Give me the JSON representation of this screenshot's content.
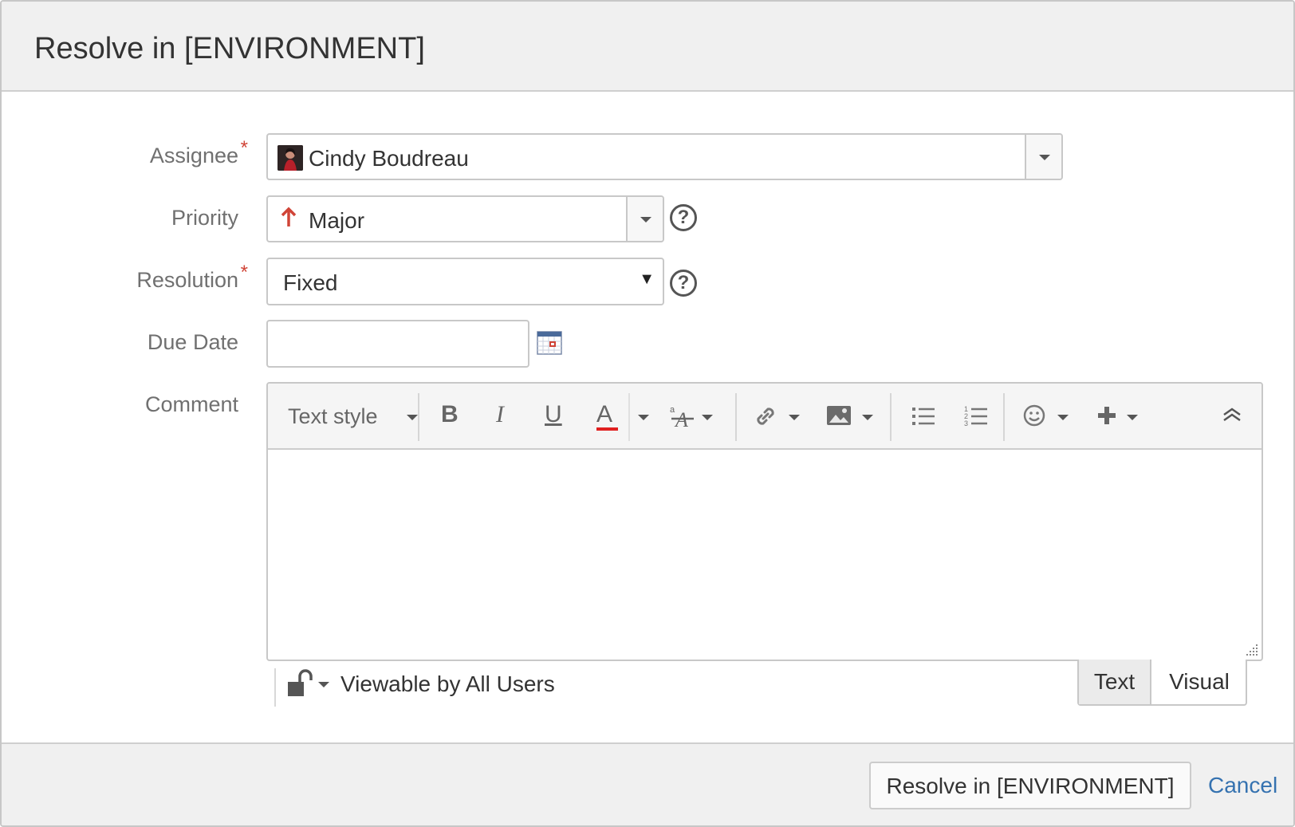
{
  "dialog": {
    "title": "Resolve in [ENVIRONMENT]"
  },
  "fields": {
    "assignee": {
      "label": "Assignee",
      "required_mark": "*",
      "value": "Cindy Boudreau"
    },
    "priority": {
      "label": "Priority",
      "value": "Major",
      "help": "?"
    },
    "resolution": {
      "label": "Resolution",
      "required_mark": "*",
      "value": "Fixed",
      "help": "?"
    },
    "due_date": {
      "label": "Due Date",
      "value": ""
    },
    "comment": {
      "label": "Comment"
    }
  },
  "toolbar": {
    "text_style": "Text style",
    "bold": "B",
    "italic": "I",
    "underline": "U",
    "text_color": "A",
    "text_color_bar": "#e02020",
    "more_format": "ᵃA"
  },
  "editor": {
    "visibility": "Viewable by All Users",
    "mode_text": "Text",
    "mode_visual": "Visual"
  },
  "footer": {
    "submit": "Resolve in [ENVIRONMENT]",
    "cancel": "Cancel"
  },
  "colors": {
    "required": "#d04437",
    "priority_arrow": "#d04437",
    "link": "#3572b0"
  }
}
